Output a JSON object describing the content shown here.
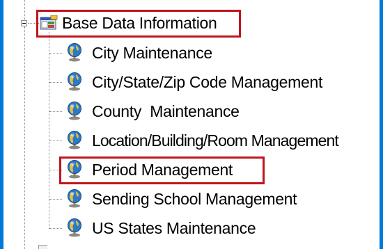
{
  "tree": {
    "root": {
      "label": "Base Data Information",
      "expanded": true,
      "icon": "window-panel-icon"
    },
    "items": [
      {
        "label": "City Maintenance",
        "icon": "globe-icon"
      },
      {
        "label": "City/State/Zip Code Management",
        "icon": "globe-icon"
      },
      {
        "label": "County  Maintenance",
        "icon": "globe-icon"
      },
      {
        "label": "Location/Building/Room Management",
        "icon": "globe-icon"
      },
      {
        "label": "Period Management",
        "icon": "globe-icon"
      },
      {
        "label": "Sending School Management",
        "icon": "globe-icon"
      },
      {
        "label": "US States Maintenance",
        "icon": "globe-icon"
      }
    ]
  },
  "colors": {
    "highlight": "#c0141c",
    "frame_border": "#0078d7",
    "tree_guide": "#8a8a8a"
  }
}
